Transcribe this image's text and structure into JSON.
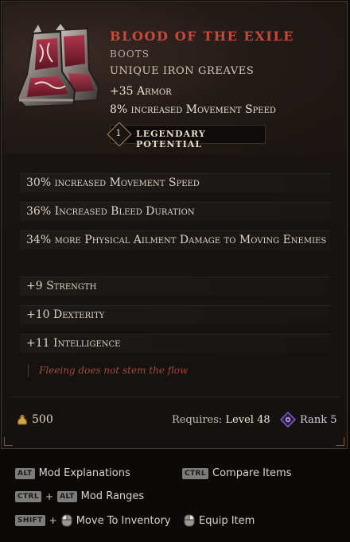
{
  "item": {
    "name": "Blood of the Exile",
    "type": "Boots",
    "base": "Unique Iron Greaves",
    "implicits": [
      "+35 Armor",
      "8% increased Movement Speed"
    ],
    "legendary_potential": {
      "count": "1",
      "label": "Legendary Potential"
    },
    "image_icon": "crimson-iron-boots-icon"
  },
  "affixes": [
    "30% increased Movement Speed",
    "36% Increased Bleed Duration",
    "34% more Physical Ailment Damage to Moving Enemies",
    "+9 Strength",
    "+10 Dexterity",
    "+11 Intelligence"
  ],
  "lore": "Fleeing does not stem the flow",
  "footer": {
    "gold_icon": "gold-pouch-icon",
    "gold_value": "500",
    "requires_label": "Requires:",
    "requires_level": "Level 48",
    "rank_icon": "rank-eye-icon",
    "rank_label": "Rank 5"
  },
  "hints": {
    "mod_explanations": {
      "key": "ALT",
      "label": "Mod Explanations"
    },
    "compare_items": {
      "key": "CTRL",
      "label": "Compare Items"
    },
    "mod_ranges": {
      "key1": "CTRL",
      "plus": "+",
      "key2": "ALT",
      "label": "Mod Ranges"
    },
    "move_to_inventory": {
      "key": "SHIFT",
      "plus": "+",
      "label": "Move To Inventory"
    },
    "equip_item": {
      "label": "Equip Item"
    }
  },
  "colors": {
    "unique_name": "#c9483a",
    "lore": "#a6493c",
    "panel_border": "#4b3a2c",
    "rank_purple": "#8a5bd6"
  }
}
